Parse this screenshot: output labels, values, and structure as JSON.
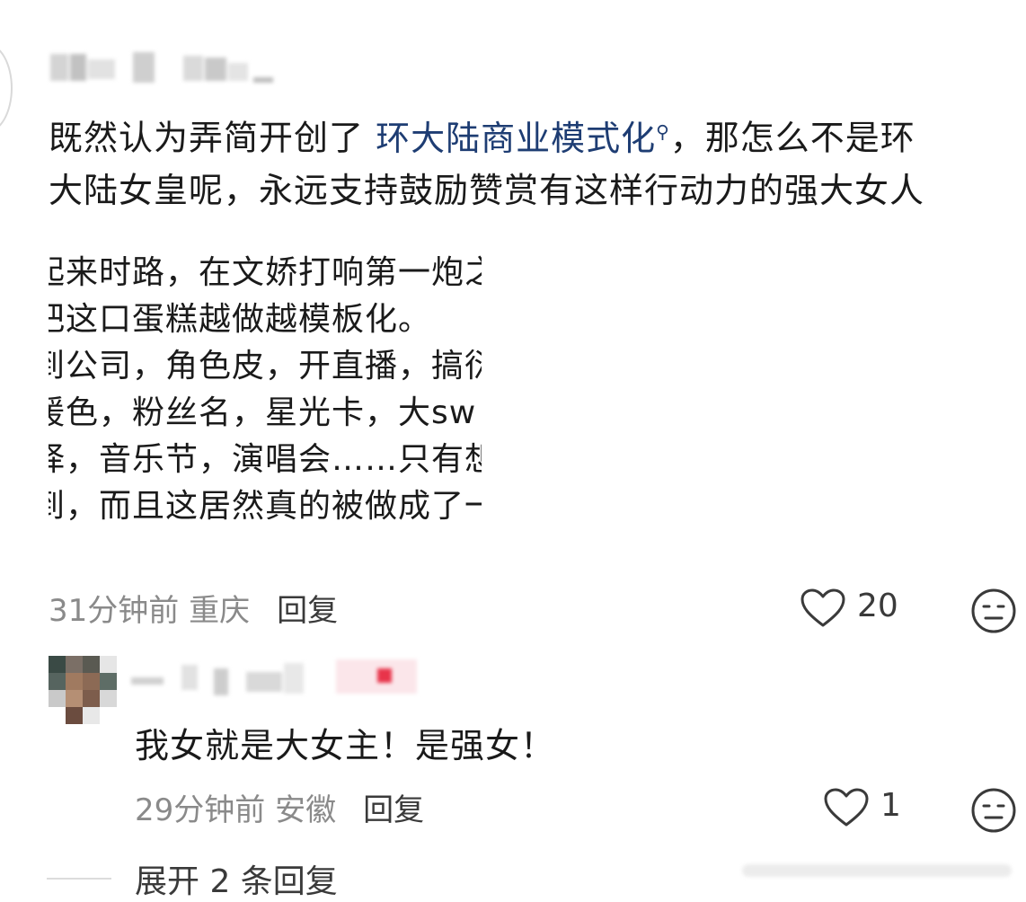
{
  "comment": {
    "text_plain_1": "既然认为弄简开创了 ",
    "text_link": "环大陆商业模式化",
    "text_plain_2": "，那怎么不是环",
    "text_line_2": "大陆女皇呢，永远支持鼓励赞赏有这样行动力的强大女人",
    "quote_lines": [
      "起来时路，在文娇打响第一炮之",
      "把这口蛋糕越做越模板化。",
      "到公司，角色皮，开直播，搞衍",
      "援色，粉丝名，星光卡，大sw",
      "择，音乐节，演唱会……只有想",
      "到，而且这居然真的被做成了一"
    ],
    "time_location": "31分钟前 重庆",
    "reply_label": "回复",
    "likes": "20"
  },
  "reply": {
    "text": "我女就是大女主！是强女！",
    "time_location": "29分钟前 安徽",
    "reply_label": "回复",
    "likes": "1"
  },
  "expand": {
    "label": "展开 2 条回复"
  },
  "colors": {
    "link": "#1e3d73",
    "meta": "#8a8a8a",
    "accent_red": "#e8344a"
  }
}
